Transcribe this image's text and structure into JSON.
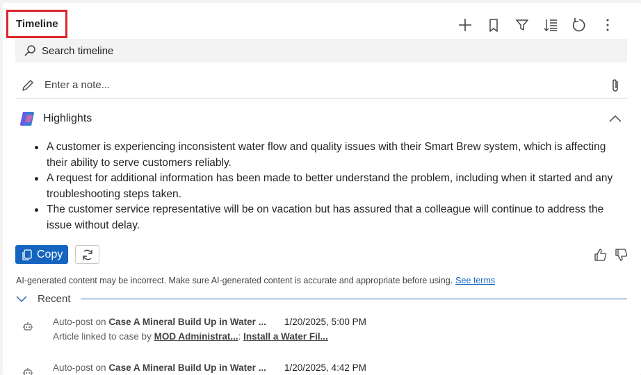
{
  "header": {
    "title": "Timeline"
  },
  "toolbar": {
    "icons": [
      "add-icon",
      "bookmark-icon",
      "filter-icon",
      "sort-icon",
      "refresh-icon",
      "more-options-icon"
    ]
  },
  "search": {
    "placeholder": "Search timeline"
  },
  "note": {
    "placeholder": "Enter a note..."
  },
  "highlights": {
    "label": "Highlights",
    "bullets": [
      "A customer is experiencing inconsistent water flow and quality issues with their Smart Brew system, which is affecting their ability to serve customers reliably.",
      "A request for additional information has been made to better understand the problem, including when it started and any troubleshooting steps taken.",
      "The customer service representative will be on vacation but has assured that a colleague will continue to address the issue without delay."
    ],
    "copy_label": "Copy",
    "disclaimer": "AI-generated content may be incorrect. Make sure AI-generated content is accurate and appropriate before using.",
    "see_terms": "See terms"
  },
  "recent": {
    "label": "Recent",
    "posts": [
      {
        "prefix": "Auto-post on ",
        "case": "Case A Mineral Build Up in Water ...",
        "date": "1/20/2025, 5:00 PM",
        "line2_prefix": "Article linked to case by ",
        "author": "MOD Administrat...",
        "sep": ": ",
        "article": "Install a Water Fil..."
      },
      {
        "prefix": "Auto-post on ",
        "case": "Case A Mineral Build Up in Water ...",
        "date": "1/20/2025, 4:42 PM"
      }
    ]
  },
  "colors": {
    "accent": "#1565c0",
    "highlight_border": "#d9252b"
  }
}
